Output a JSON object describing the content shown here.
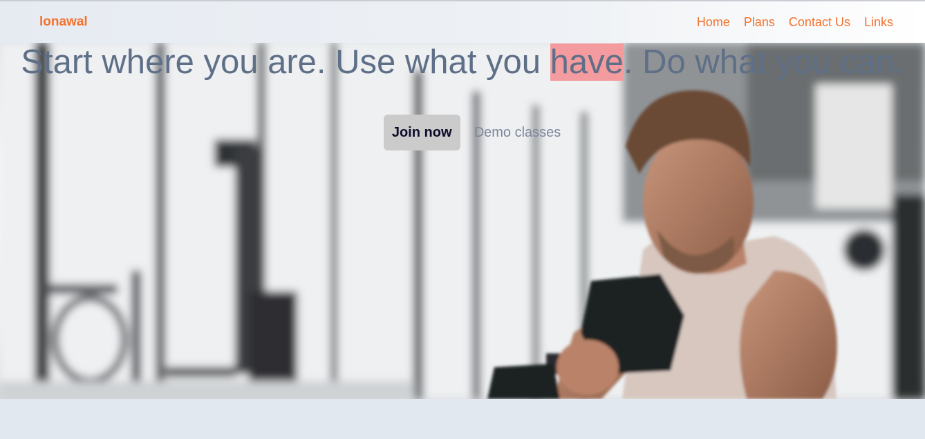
{
  "brand": {
    "name": "lonawal",
    "color": "#f4722b"
  },
  "nav": {
    "links": [
      {
        "label": "Home"
      },
      {
        "label": "Plans"
      },
      {
        "label": "Contact Us"
      },
      {
        "label": "Links"
      }
    ]
  },
  "hero": {
    "headline_part1": "Start where you are. Use what you ",
    "headline_highlight": "have",
    "headline_part2": ". Do what you can.",
    "highlight_color": "#f39b9e",
    "join_label": "Join now",
    "demo_label": "Demo classes",
    "image_subject": "man-lifting-dumbbell-in-gym"
  }
}
